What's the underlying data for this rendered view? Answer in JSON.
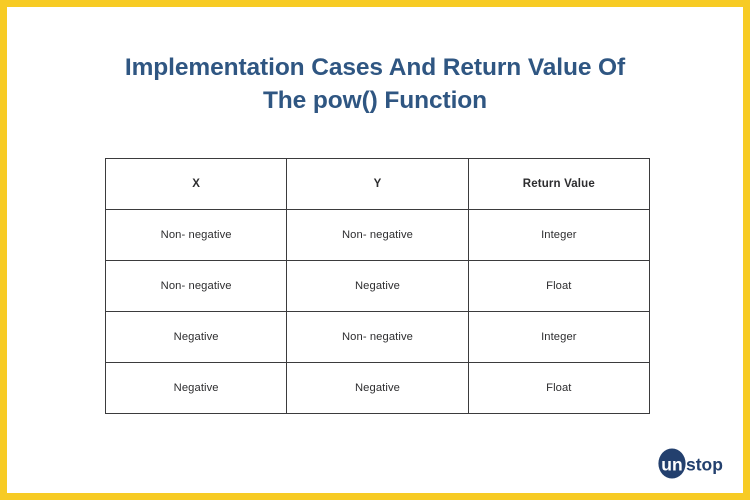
{
  "slide": {
    "border_color": "#F7CB24",
    "background_color": "#FFFFFF"
  },
  "title": {
    "line1": "Implementation Cases And Return Value Of",
    "line2": "The pow() Function",
    "color": "#2F5682"
  },
  "table": {
    "headers": [
      "X",
      "Y",
      "Return Value"
    ],
    "rows": [
      [
        "Non- negative",
        "Non- negative",
        "Integer"
      ],
      [
        "Non- negative",
        "Negative",
        "Float"
      ],
      [
        "Negative",
        "Non- negative",
        "Integer"
      ],
      [
        "Negative",
        "Negative",
        "Float"
      ]
    ],
    "border_color": "#3B3B3D",
    "text_color": "#2D2D2F"
  },
  "logo": {
    "mark_text": "un",
    "word_text": "stop",
    "color": "#23406E",
    "mark_text_color": "#FFFFFF"
  }
}
